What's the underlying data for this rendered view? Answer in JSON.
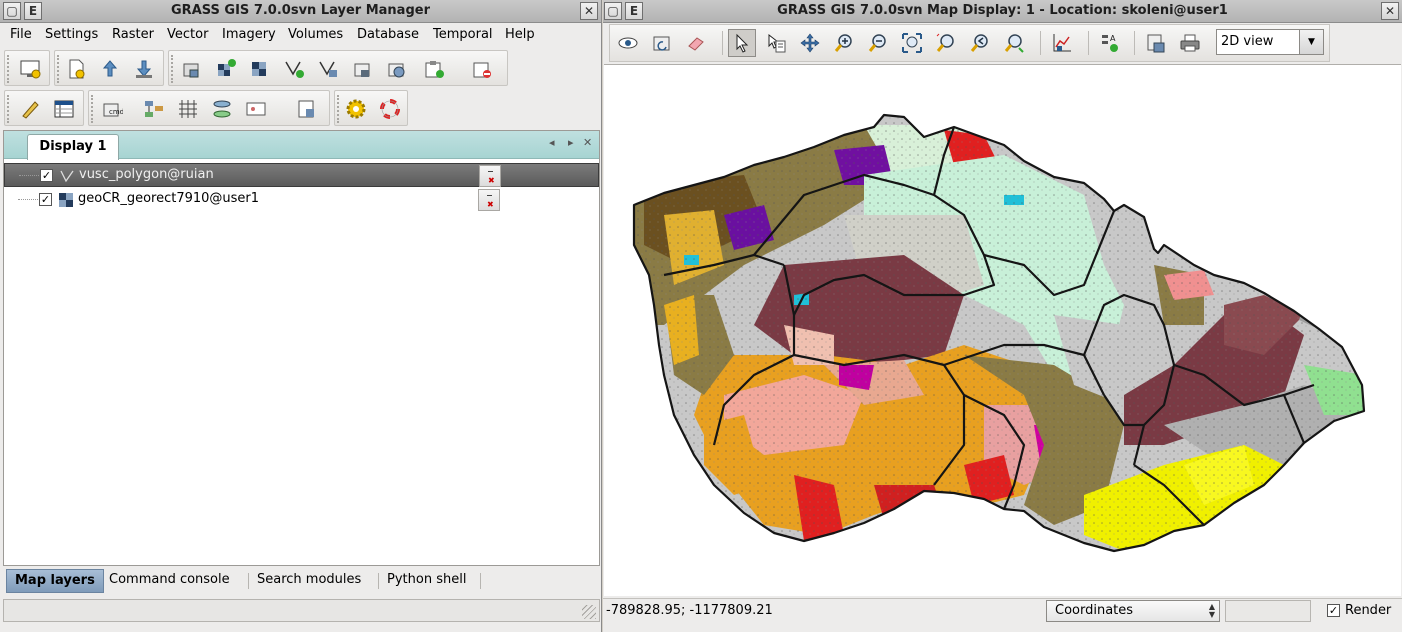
{
  "layer_manager": {
    "title": "GRASS GIS 7.0.0svn Layer Manager",
    "window_buttons": {
      "menu": "E"
    },
    "menu": [
      "File",
      "Settings",
      "Raster",
      "Vector",
      "Imagery",
      "Volumes",
      "Database",
      "Temporal",
      "Help"
    ],
    "display_tab": "Display 1",
    "layers": [
      {
        "name": "vusc_polygon@ruian",
        "checked": true,
        "type": "vector",
        "selected": true
      },
      {
        "name": "geoCR_georect7910@user1",
        "checked": true,
        "type": "raster",
        "selected": false
      }
    ],
    "bottom_tabs": [
      "Map layers",
      "Command console",
      "Search modules",
      "Python shell"
    ],
    "active_bottom_tab": "Map layers"
  },
  "map_display": {
    "title": "GRASS GIS 7.0.0svn Map Display: 1  - Location: skoleni@user1",
    "window_buttons": {
      "menu": "E"
    },
    "view_mode": "2D view",
    "coordinates": "-789828.95; -1177809.21",
    "status_mode": "Coordinates",
    "render_label": "Render",
    "render_checked": true
  },
  "icons": {
    "checked_mark": "✓"
  }
}
